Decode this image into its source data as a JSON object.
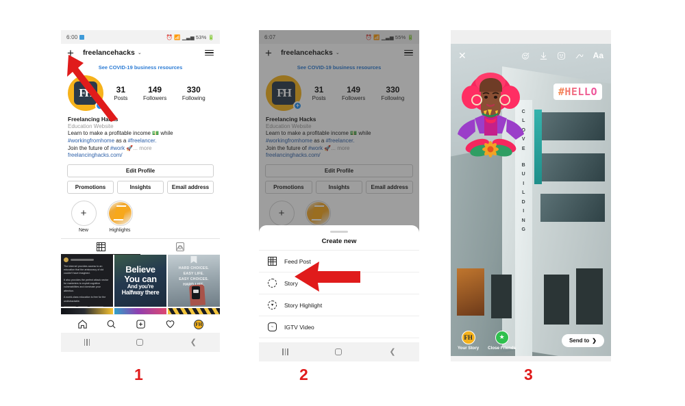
{
  "phone1": {
    "status": {
      "time": "6:00",
      "battery": "53%",
      "icons": [
        "alarm-icon",
        "wifi-icon",
        "signal-icon",
        "battery-icon"
      ]
    },
    "header": {
      "plus": "+",
      "username": "freelancehacks",
      "caret": "⌄",
      "menu": "hamburger-icon"
    },
    "covid_banner": "See COVID-19 business resources",
    "profile": {
      "avatar_initials": "FH",
      "badge": "+",
      "stats": [
        {
          "num": "31",
          "label": "Posts"
        },
        {
          "num": "149",
          "label": "Followers"
        },
        {
          "num": "330",
          "label": "Following"
        }
      ],
      "name": "Freelancing Hacks",
      "category": "Education Website",
      "bio_line1": "Learn to make a profitable income 💵 while",
      "bio_tag1": "#workingfromhome",
      "bio_mid1": " as a ",
      "bio_tag2": "#freelancer.",
      "bio_line3a": "Join the future of ",
      "bio_tag3": "#work",
      "bio_emoji": " 🚀",
      "bio_more": "... more",
      "website": "freelancinghacks.com/"
    },
    "buttons": {
      "edit": "Edit Profile",
      "promotions": "Promotions",
      "insights": "Insights",
      "email": "Email address"
    },
    "highlights": [
      {
        "label": "New",
        "icon": "plus-icon"
      },
      {
        "label": "Highlights",
        "icon": "highlight-cover"
      }
    ],
    "tabs": [
      {
        "name": "grid-tab",
        "active": true
      },
      {
        "name": "tagged-tab",
        "active": false
      }
    ],
    "posts": [
      {
        "id": "post-article",
        "text1": "The internet provides access to an education that the aristocracy of old couldn't have imagined.",
        "text2": "It also provides the perfect attack vector for marketers to exploit cognitive vulnerabilities and dominate your attention.",
        "text3": "A world-class education is free for the undistractable."
      },
      {
        "id": "post-believe",
        "l1": "Believe",
        "l2": "You can",
        "l3": "And you're",
        "l4": "Halfway there"
      },
      {
        "id": "post-hard-choices",
        "t1": "HARD CHOICES.",
        "t2": "EASY LIFE.",
        "t3": "EASY CHOICES.",
        "t4": "HARD LIFE."
      },
      {
        "id": "post-row2-a"
      },
      {
        "id": "post-row2-b"
      },
      {
        "id": "post-row2-c"
      }
    ],
    "bottom_nav": [
      "home-icon",
      "search-icon",
      "add-post-icon",
      "activity-icon",
      "profile-avatar-icon"
    ],
    "android_nav": [
      "recents-button",
      "home-button",
      "back-button"
    ]
  },
  "phone2": {
    "status": {
      "time": "6:07",
      "battery": "55%"
    },
    "header": {
      "plus": "+",
      "username": "freelancehacks",
      "caret": "⌄"
    },
    "covid_banner": "See COVID-19 business resources",
    "sheet": {
      "title": "Create new",
      "items": [
        {
          "label": "Feed Post",
          "icon": "grid-icon"
        },
        {
          "label": "Story",
          "icon": "story-circle-icon"
        },
        {
          "label": "Story Highlight",
          "icon": "highlight-heart-icon"
        },
        {
          "label": "IGTV Video",
          "icon": "igtv-icon"
        }
      ]
    }
  },
  "phone3": {
    "toolbar": {
      "close": "✕",
      "tools": [
        {
          "name": "effects-icon",
          "glyph": "☺"
        },
        {
          "name": "download-icon",
          "glyph": "⤓"
        },
        {
          "name": "sticker-icon",
          "glyph": "☺"
        },
        {
          "name": "draw-icon",
          "glyph": "✎"
        },
        {
          "name": "text-icon",
          "glyph": "Aa"
        }
      ]
    },
    "sticker_hello": "#HELLO",
    "building_text": [
      "C",
      "L",
      "O",
      "V",
      "E",
      "B",
      "U",
      "I",
      "L",
      "D",
      "I",
      "N",
      "G"
    ],
    "bottom": {
      "your_story": {
        "label": "Your Story",
        "initials": "FH"
      },
      "close_friends": {
        "label": "Close Friends",
        "glyph": "★"
      },
      "send_to": "Send to",
      "send_chevron": "❯"
    }
  },
  "step_numbers": {
    "one": "1",
    "two": "2",
    "three": "3"
  },
  "colors": {
    "accent_red": "#e01b1b",
    "ig_blue": "#2b7bd4",
    "brand_yellow": "#f6b21b"
  }
}
